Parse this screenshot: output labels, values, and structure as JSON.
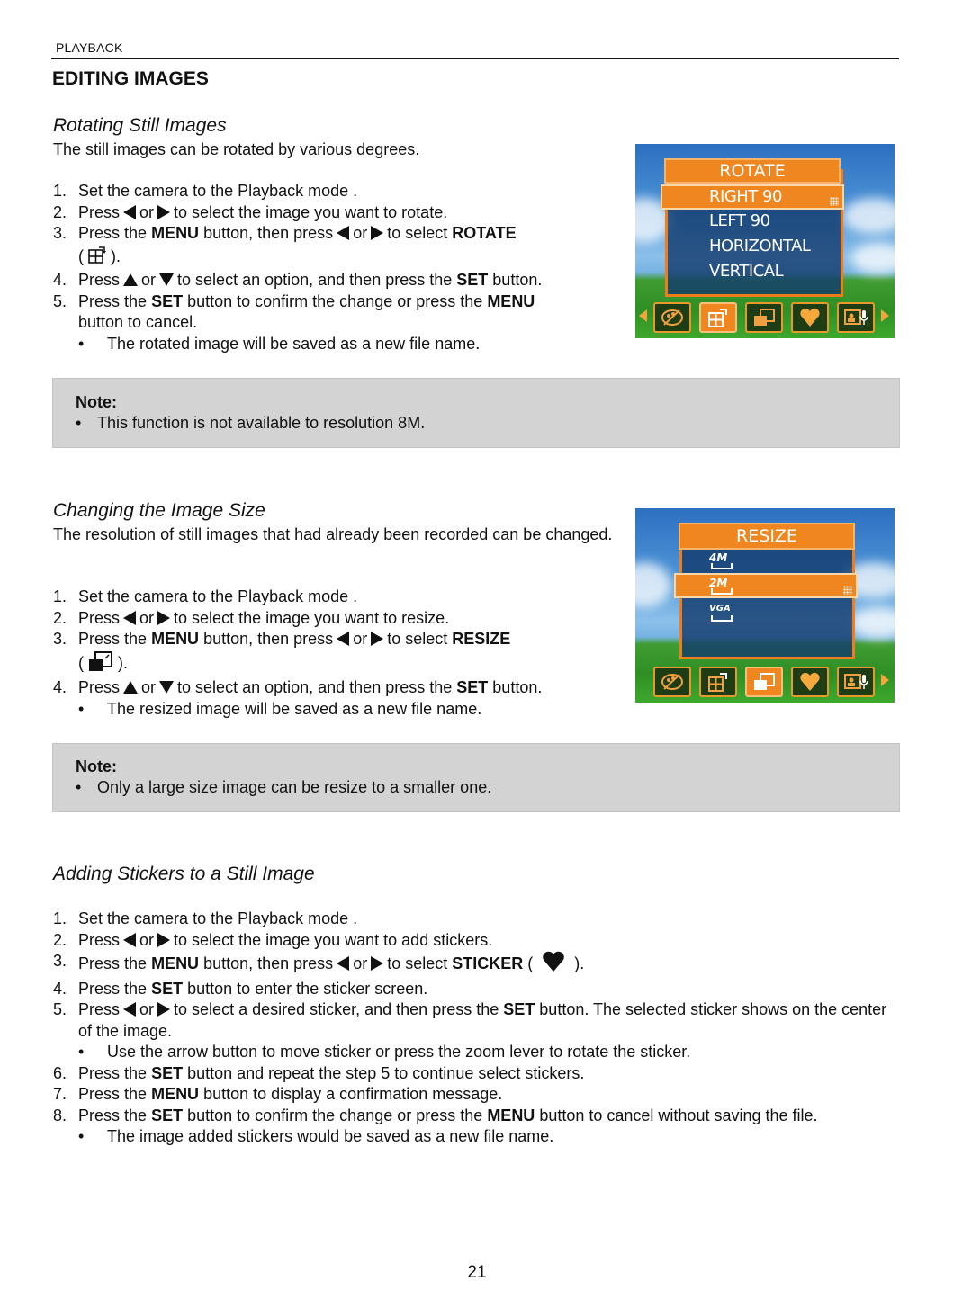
{
  "header": {
    "section_label": "PLAYBACK",
    "page_title": "EDITING IMAGES"
  },
  "rotate": {
    "title": "Rotating Still Images",
    "intro": "The still images can be rotated by various degrees.",
    "steps": [
      {
        "num": "1.",
        "text": "Set the camera to the Playback mode ."
      },
      {
        "num": "2.",
        "pre": "Press",
        "or": "or",
        "post": "to select the image you want to rotate."
      },
      {
        "num": "3.",
        "a": "Press the",
        "menu": "MENU",
        "b": "button, then press",
        "or": "or",
        "c": "to select",
        "target": "ROTATE",
        "open": "(",
        "close": ")."
      },
      {
        "num": "4.",
        "pre": "Press",
        "or": "or",
        "a": "to select an option, and then press the",
        "set": "SET",
        "b": "button."
      },
      {
        "num": "5.",
        "a": "Press the",
        "set": "SET",
        "b": "button to confirm the change or press the",
        "menu": "MENU",
        "c": "button to cancel."
      }
    ],
    "bullet": "The rotated image will be saved as a new file name.",
    "note_title": "Note:",
    "note_text": "This function is not available to resolution 8M.",
    "screen": {
      "menu_title": "ROTATE",
      "options": [
        "RIGHT 90",
        "LEFT 90",
        "HORIZONTAL",
        "VERTICAL"
      ],
      "selected_option": "RIGHT 90",
      "toolbar": [
        "color-effect",
        "rotate",
        "resize",
        "sticker",
        "voice-memo"
      ],
      "selected_tool": "rotate"
    }
  },
  "resize": {
    "title": "Changing the Image Size",
    "intro": "The resolution of still images that had already been recorded can be changed.",
    "steps": [
      {
        "num": "1.",
        "text": "Set the camera to the Playback mode ."
      },
      {
        "num": "2.",
        "pre": "Press",
        "or": "or",
        "post": "to select the image you want to resize."
      },
      {
        "num": "3.",
        "a": "Press the",
        "menu": "MENU",
        "b": "button, then press",
        "or": "or",
        "c": "to select",
        "target": "RESIZE",
        "open": "(",
        "close": ")."
      },
      {
        "num": "4.",
        "pre": "Press",
        "or": "or",
        "a": "to select an option, and then press the",
        "set": "SET",
        "b": "button."
      }
    ],
    "bullet": "The resized image will be saved as a new file name.",
    "note_title": "Note:",
    "note_text": "Only a large size image can be resize to a smaller one.",
    "screen": {
      "menu_title": "RESIZE",
      "options": [
        "4M",
        "2M",
        "VGA"
      ],
      "selected_option": "2M",
      "toolbar": [
        "color-effect",
        "rotate",
        "resize",
        "sticker",
        "voice-memo"
      ],
      "selected_tool": "resize"
    }
  },
  "sticker": {
    "title": "Adding Stickers to a Still Image",
    "steps": [
      {
        "num": "1.",
        "text": "Set the camera to the Playback mode ."
      },
      {
        "num": "2.",
        "pre": "Press",
        "or": "or",
        "post": "to select the image you want to add stickers."
      },
      {
        "num": "3.",
        "a": "Press the",
        "menu": "MENU",
        "b": "button, then press",
        "or": "or",
        "c": "to select",
        "target": "STICKER",
        "open": "(",
        "close": ")."
      },
      {
        "num": "4.",
        "a": "Press the",
        "set": "SET",
        "b": "button to enter the sticker screen."
      },
      {
        "num": "5.",
        "pre": "Press",
        "or": "or",
        "a": "to select a desired sticker, and then press the",
        "set": "SET",
        "b": "button.  The selected sticker shows on the center of the image."
      },
      {
        "num": "6.",
        "a": "Press the",
        "set": "SET",
        "b": "button and repeat the step 5 to continue select stickers."
      },
      {
        "num": "7.",
        "a": "Press the",
        "menu": "MENU",
        "b": "button to display a confirmation message."
      },
      {
        "num": "8.",
        "a": "Press the",
        "set": "SET",
        "b": "button to confirm the change or press the",
        "menu": "MENU",
        "c": "button to cancel without saving the file."
      }
    ],
    "bullet_5": "Use the arrow button to move sticker or press the zoom lever to rotate the sticker.",
    "bullet_8": "The image added stickers would be saved as a new file name."
  },
  "footer": {
    "page_number": "21"
  }
}
